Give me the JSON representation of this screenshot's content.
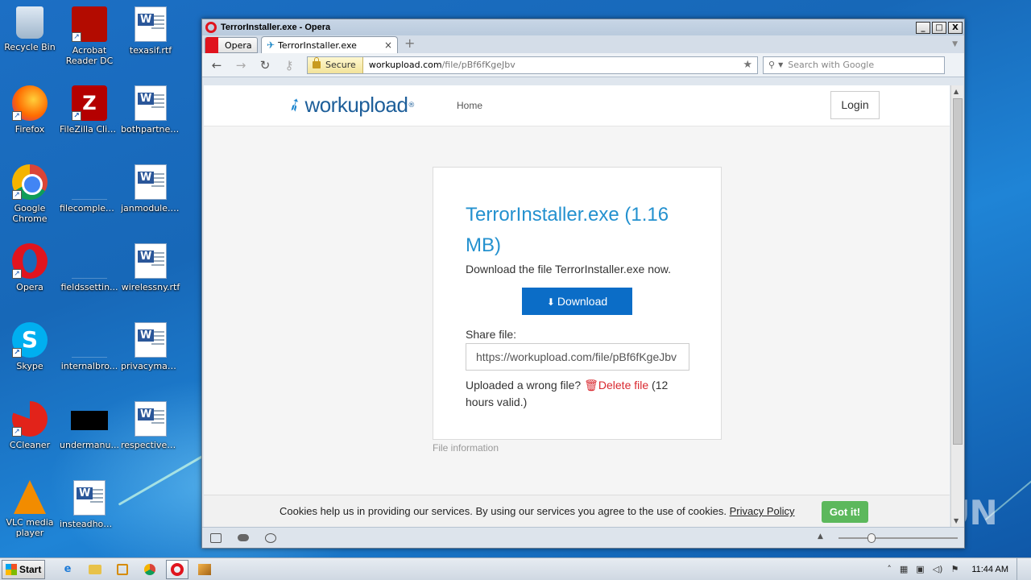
{
  "desktop": {
    "icons": [
      {
        "label": "Recycle Bin"
      },
      {
        "label": "Acrobat Reader DC"
      },
      {
        "label": "texasif.rtf"
      },
      {
        "label": "Firefox"
      },
      {
        "label": "FileZilla Client"
      },
      {
        "label": "bothpartner..."
      },
      {
        "label": "Google Chrome"
      },
      {
        "label": "filecomplex...."
      },
      {
        "label": "janmodule.rtf"
      },
      {
        "label": "Opera"
      },
      {
        "label": "fieldssettin..."
      },
      {
        "label": "wirelessny.rtf"
      },
      {
        "label": "Skype"
      },
      {
        "label": "internalbro..."
      },
      {
        "label": "privacyman..."
      },
      {
        "label": "CCleaner"
      },
      {
        "label": "undermanu..."
      },
      {
        "label": "respectivem..."
      },
      {
        "label": "VLC media player"
      },
      {
        "label": "insteadhom..."
      }
    ]
  },
  "window": {
    "title": "TerrorInstaller.exe - Opera",
    "controls": {
      "minimize": "_",
      "maximize": "□",
      "close": "X"
    }
  },
  "tabs": {
    "menu_label": "Opera",
    "active_tab": "TerrorInstaller.exe",
    "close": "×",
    "new_tab": "+"
  },
  "navigation": {
    "back": "←",
    "forward": "→",
    "reload": "↻",
    "secure_label": "Secure",
    "url_host": "workupload.com",
    "url_path": "/file/pBf6fKgeJbv",
    "search_placeholder": "Search with Google"
  },
  "site": {
    "logo_text": "workupload",
    "logo_reg": "®",
    "nav_home": "Home",
    "login": "Login"
  },
  "file": {
    "title": "TerrorInstaller.exe (1.16 MB)",
    "subtitle": "Download the file TerrorInstaller.exe now.",
    "download_label": "Download",
    "share_label": "Share file:",
    "share_url": "https://workupload.com/file/pBf6fKgeJbv",
    "wrong_text": "Uploaded a wrong file?",
    "delete_label": "Delete file",
    "valid_text": "(12 hours valid.)",
    "info_label": "File information"
  },
  "cookie": {
    "text": "Cookies help us in providing our services. By using our services you agree to the use of cookies.",
    "policy_link": "Privacy Policy",
    "button": "Got it!"
  },
  "watermark": "ANY.RUN",
  "taskbar": {
    "start": "Start",
    "clock": "11:44 AM"
  },
  "colors": {
    "brand_blue": "#2491cf",
    "download_button": "#0b6dc7",
    "delete_red": "#d9282f",
    "gotit_green": "#5cb85c"
  }
}
